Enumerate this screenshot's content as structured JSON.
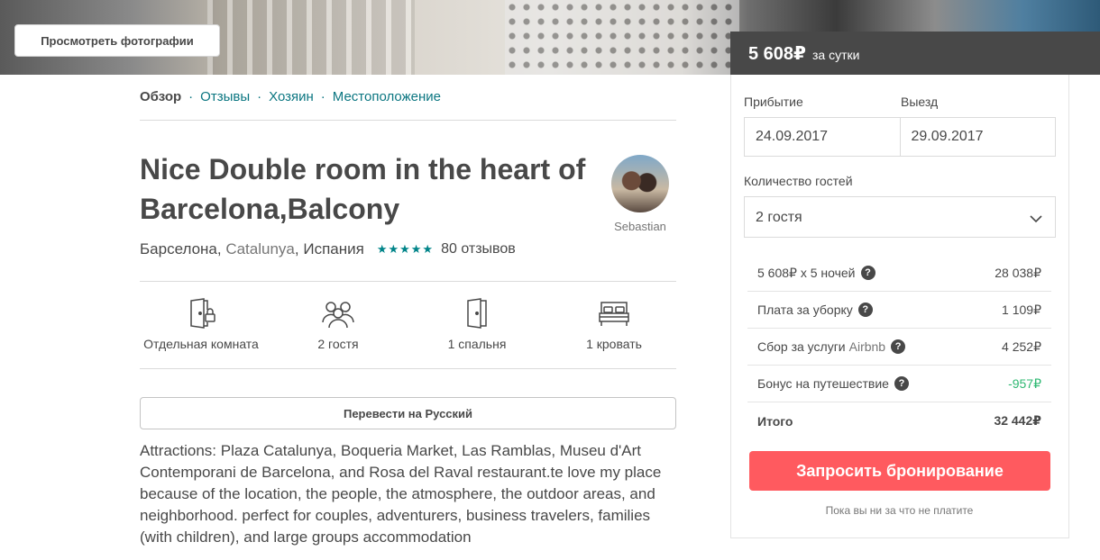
{
  "hero": {
    "photos_button": "Просмотреть фотографии"
  },
  "subnav": {
    "items": [
      {
        "label": "Обзор",
        "active": true
      },
      {
        "label": "Отзывы"
      },
      {
        "label": "Хозяин"
      },
      {
        "label": "Местоположение"
      }
    ],
    "separator": "·"
  },
  "listing": {
    "title": "Nice Double room in the heart of Barcelona,Balcony",
    "host_name": "Sebastian",
    "city": "Барселона",
    "region": "Catalunya",
    "country": "Испания",
    "rating": 4.5,
    "stars_glyphs": "★★★★★",
    "reviews": "80 отзывов",
    "amenities": [
      {
        "icon": "door-lock-icon",
        "label": "Отдельная комната"
      },
      {
        "icon": "guests-icon",
        "label": "2 гостя"
      },
      {
        "icon": "door-icon",
        "label": "1 спальня"
      },
      {
        "icon": "bed-icon",
        "label": "1 кровать"
      }
    ],
    "translate_button": "Перевести на Русский",
    "description": "Attractions: Plaza Catalunya, Boqueria Market, Las Ramblas, Museu d'Art Contemporani de Barcelona, and Rosa del Raval restaurant.te love my place because of the location, the people, the atmosphere, the outdoor areas, and neighborhood. perfect for couples, adventurers, business travelers, families (with children), and large groups accommodation"
  },
  "booking": {
    "price": "5 608₽",
    "per": "за сутки",
    "checkin_label": "Прибытие",
    "checkout_label": "Выезд",
    "checkin": "24.09.2017",
    "checkout": "29.09.2017",
    "guests_label": "Количество гостей",
    "guests_value": "2 гостя",
    "fees": [
      {
        "label": "5 608₽ x 5 ночей",
        "amount": "28 038₽",
        "help": true
      },
      {
        "label": "Плата за уборку",
        "amount": "1 109₽",
        "help": true
      },
      {
        "label": "Сбор за услуги",
        "suffix": "Airbnb",
        "amount": "4 252₽",
        "help": true
      },
      {
        "label": "Бонус на путешествие",
        "amount": "-957₽",
        "help": true,
        "color": "#2eb872"
      }
    ],
    "total_label": "Итого",
    "total_amount": "32 442₽",
    "book_button": "Запросить бронирование",
    "note": "Пока вы ни за что не платите"
  },
  "colors": {
    "accent": "#ff5a5f",
    "link": "#0b7681",
    "discount": "#2eb872"
  }
}
